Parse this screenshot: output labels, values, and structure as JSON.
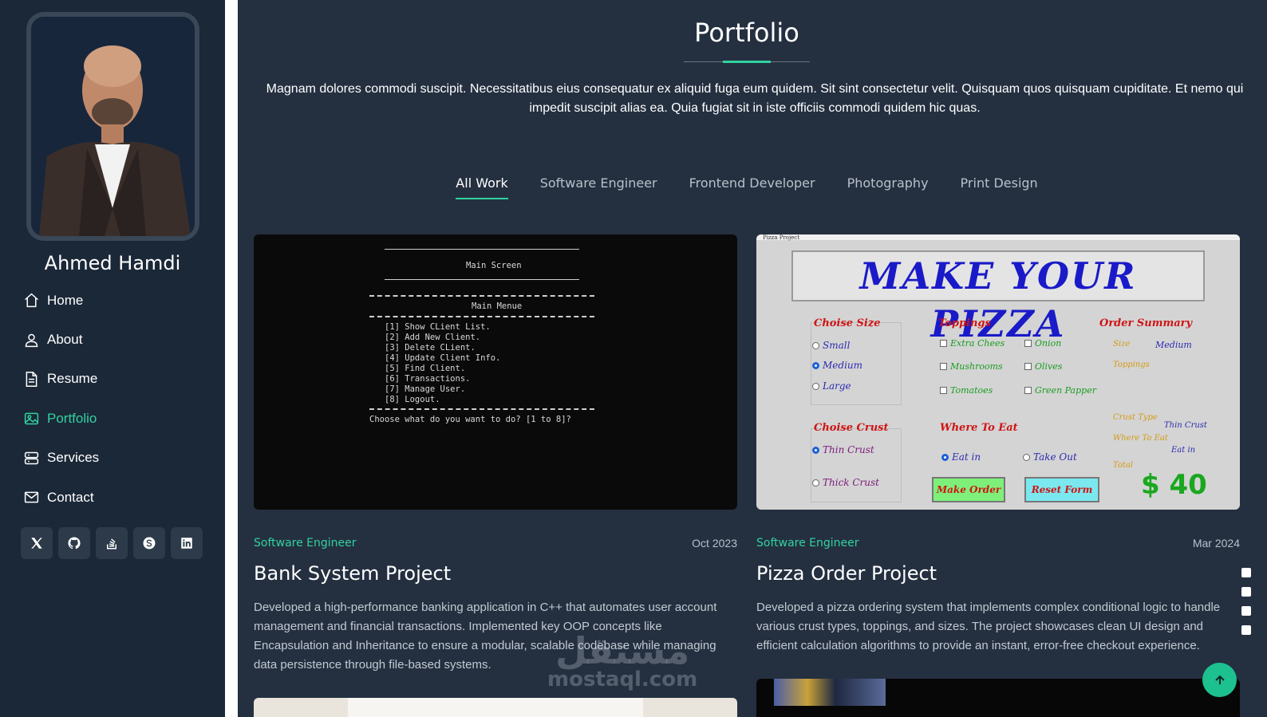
{
  "profile": {
    "name": "Ahmed Hamdi"
  },
  "nav": [
    {
      "label": "Home",
      "icon": "home-icon"
    },
    {
      "label": "About",
      "icon": "person-icon"
    },
    {
      "label": "Resume",
      "icon": "file-icon"
    },
    {
      "label": "Portfolio",
      "icon": "images-icon",
      "active": true
    },
    {
      "label": "Services",
      "icon": "server-icon"
    },
    {
      "label": "Contact",
      "icon": "envelope-icon"
    }
  ],
  "socials": [
    "x-icon",
    "github-icon",
    "stackoverflow-icon",
    "skype-icon",
    "linkedin-icon"
  ],
  "colors": {
    "accent": "#31d2a0",
    "sidebar": "#1b2838",
    "main": "#243040"
  },
  "portfolio": {
    "title": "Portfolio",
    "description": "Magnam dolores commodi suscipit. Necessitatibus eius consequatur ex aliquid fuga eum quidem. Sit sint consectetur velit. Quisquam quos quisquam cupiditate. Et nemo qui impedit suscipit alias ea. Quia fugiat sit in iste officiis commodi quidem hic quas.",
    "filters": [
      "All Work",
      "Software Engineer",
      "Frontend Developer",
      "Photography",
      "Print Design"
    ],
    "active_filter": "All Work"
  },
  "cards": [
    {
      "category": "Software Engineer",
      "date": "Oct 2023",
      "title": "Bank System Project",
      "description": "Developed a high-performance banking application in C++ that automates user account management and financial transactions. Implemented key OOP concepts like Encapsulation and Inheritance to ensure a modular, scalable codebase while managing data persistence through file-based systems.",
      "terminal": {
        "header": "Main Screen",
        "menu_title": "Main Menue",
        "items": [
          "[1] Show CLient List.",
          "[2] Add New Client.",
          "[3] Delete CLient.",
          "[4] Update Client Info.",
          "[5] Find Client.",
          "[6] Transactions.",
          "[7] Manage User.",
          "[8] Logout."
        ],
        "prompt": "Choose what do you want to do? [1 to 8]?"
      }
    },
    {
      "category": "Software Engineer",
      "date": "Mar 2024",
      "title": "Pizza Order Project",
      "description": "Developed a pizza ordering system that implements complex conditional logic to handle various crust types, toppings, and sizes. The project showcases clean UI design and efficient calculation algorithms to provide an instant, error-free checkout experience.",
      "app": {
        "window_title": "Pizza Project",
        "banner": "MAKE YOUR PIZZA",
        "size_title": "Choise Size",
        "sizes": [
          "Small",
          "Medium",
          "Large"
        ],
        "toppings_title": "Toppings",
        "toppings": [
          "Extra Chees",
          "Onion",
          "Mushrooms",
          "Olives",
          "Tomatoes",
          "Green Papper"
        ],
        "summary_title": "Order Summary",
        "summary_size_label": "Size",
        "summary_size_value": "Medium",
        "summary_toppings_label": "Toppings",
        "crust_title": "Choise Crust",
        "crusts": [
          "Thin Crust",
          "Thick Crust"
        ],
        "where_title": "Where To Eat",
        "where": [
          "Eat in",
          "Take Out"
        ],
        "summary_crust_label": "Crust Type",
        "summary_crust_value": "Thin Crust",
        "summary_where_label": "Where To Eat",
        "summary_where_value": "Eat in",
        "summary_total_label": "Total",
        "make_order": "Make Order",
        "reset": "Reset Form",
        "total": "$ 40"
      }
    }
  ],
  "watermark": {
    "arabic": "مستقل",
    "latin": "mostaql.com"
  }
}
